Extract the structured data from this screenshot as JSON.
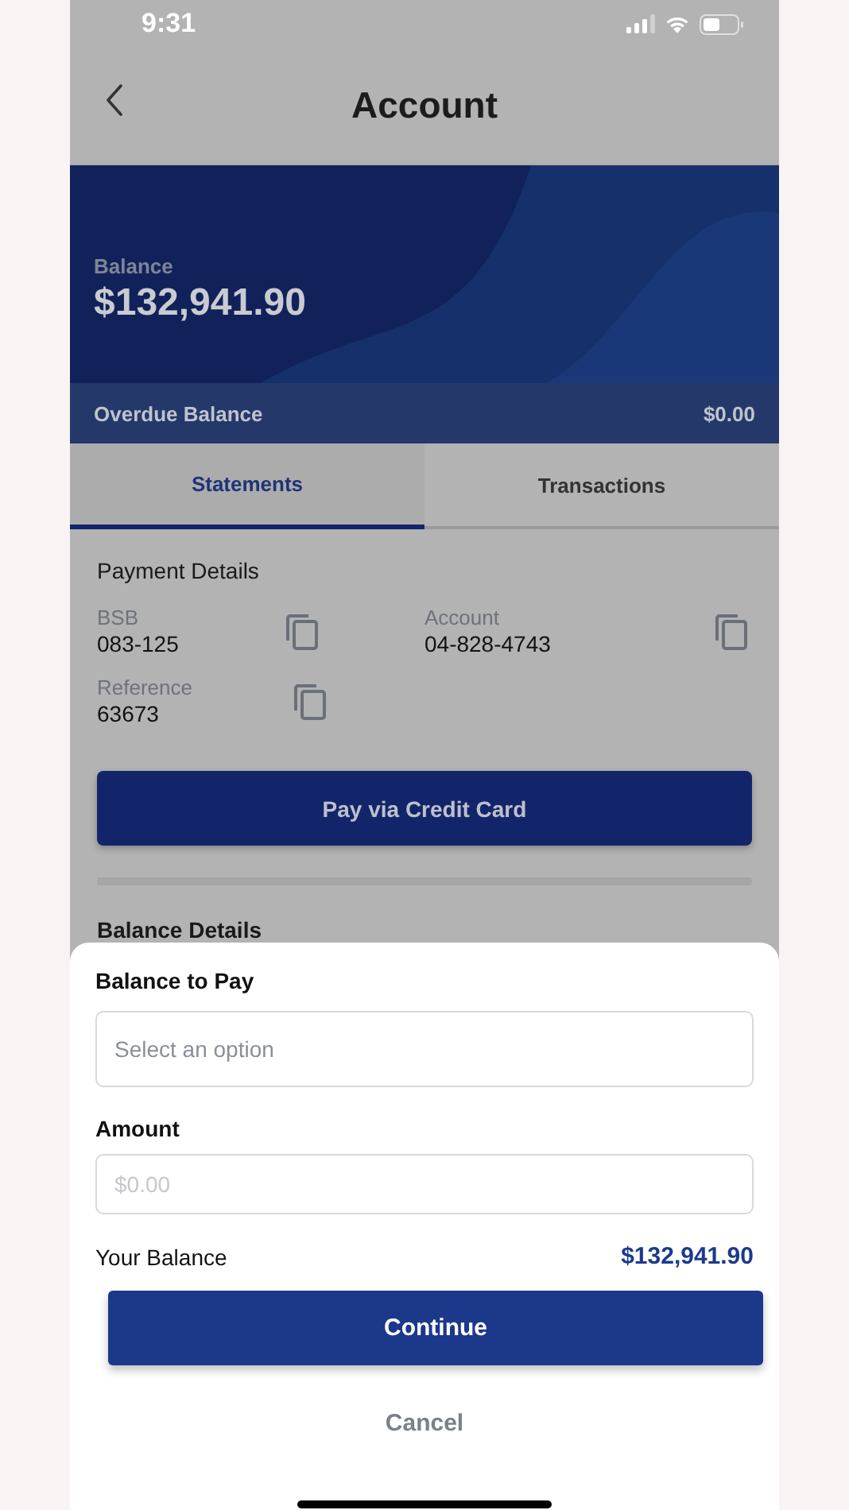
{
  "status_bar": {
    "time": "9:31"
  },
  "header": {
    "title": "Account"
  },
  "balance_card": {
    "label": "Balance",
    "amount": "$132,941.90",
    "overdue_label": "Overdue Balance",
    "overdue_amount": "$0.00"
  },
  "tabs": [
    {
      "label": "Statements",
      "selected": true
    },
    {
      "label": "Transactions",
      "selected": false
    }
  ],
  "payment_details": {
    "title": "Payment Details",
    "items": [
      {
        "label": "BSB",
        "value": "083-125"
      },
      {
        "label": "Account",
        "value": "04-828-4743"
      },
      {
        "label": "Reference",
        "value": "63673"
      }
    ],
    "button": "Pay via Credit Card"
  },
  "balance_details": {
    "title": "Balance Details"
  },
  "sheet": {
    "balance_label": "Balance to Pay",
    "select_placeholder": "Select an option",
    "amount_label": "Amount",
    "amount_placeholder": "$0.00",
    "your_balance_label": "Your Balance",
    "your_balance": "$132,941.90",
    "continue": "Continue",
    "cancel": "Cancel"
  }
}
